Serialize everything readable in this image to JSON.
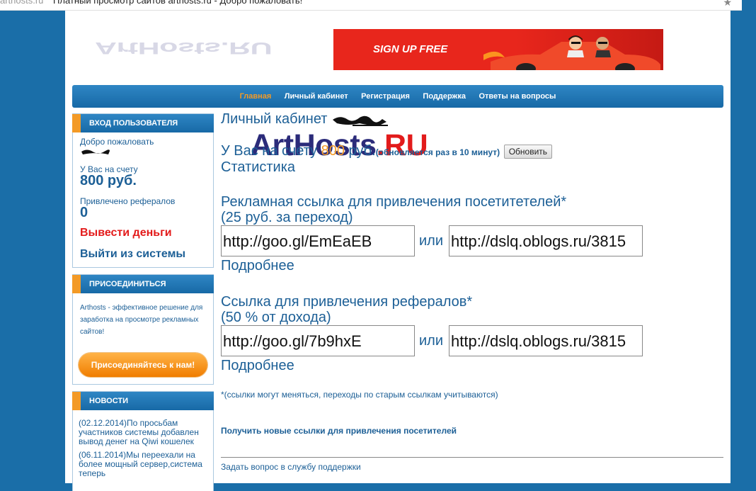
{
  "browser": {
    "url": "arthosts.ru",
    "title": "Платный просмотр сайтов arthosts.ru - Добро пожаловать!",
    "star": "★"
  },
  "logo": {
    "main": "ArtHosts",
    "suffix": ".RU"
  },
  "banner": {
    "text": "SIGN UP FREE"
  },
  "nav": {
    "items": [
      "Главная",
      "Личный кабинет",
      "Регистрация",
      "Поддержка",
      "Ответы на вопросы"
    ]
  },
  "login_box": {
    "title": "ВХОД ПОЛЬЗОВАТЕЛЯ",
    "welcome": "Добро пожаловать",
    "balance_label": "У Вас на счету",
    "balance_value": "800 руб.",
    "referrals_label": "Привлечено рефералов",
    "referrals_value": "0",
    "withdraw": "Вывести деньги",
    "logout": "Выйти из системы"
  },
  "join_box": {
    "title": "ПРИСОЕДИНИТЬСЯ",
    "text": "Arthosts - эффективное решение для заработка на просмотре рекламных сайтов!",
    "button": "Присоединяйтесь к нам!"
  },
  "news_box": {
    "title": "НОВОСТИ",
    "items": [
      "(02.12.2014)По просьбам участников системы добавлен вывод денег на Qiwi кошелек",
      "(06.11.2014)Мы переехали на более мощный сервер,система теперь"
    ]
  },
  "main": {
    "cabinet_title": "Личный кабинет",
    "balance_prefix": "У Вас на счету",
    "balance_num": "800",
    "balance_suffix": "руб.",
    "update_note": "(обновляется раз в 10 минут)",
    "refresh_button": "Обновить",
    "statistics": "Статистика",
    "ad_link_title": "Рекламная ссылка для привлечения посетитетелей*",
    "ad_link_rate": "(25 руб. за переход)",
    "ad_link_short": "http://goo.gl/EmEaEB",
    "ad_link_long": "http://dslq.oblogs.ru/3815",
    "or": "или",
    "more": "Подробнее",
    "ref_link_title": "Ссылка для привлечения рефералов*",
    "ref_link_rate": "(50 % от дохода)",
    "ref_link_short": "http://goo.gl/7b9hxE",
    "ref_link_long": "http://dslq.oblogs.ru/3815",
    "note": "*(ссылки могут меняться, переходы по старым ссылкам учитываются)",
    "get_new_links": "Получить новые ссылки для привлечения посетителей",
    "support": "Задать вопрос в службу поддержки"
  }
}
